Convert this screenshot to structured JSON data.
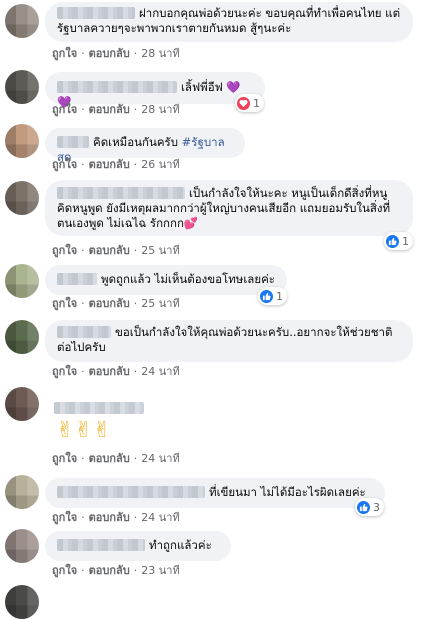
{
  "action_labels": {
    "like": "ถูกใจ",
    "reply": "ตอบกลับ",
    "separator": "·"
  },
  "comments": [
    {
      "text": "ฝากบอกคุณพ่อด้วยนะค่ะ ขอบคุณที่ทำเพื่อคนไทย แต่รัฐบาลควายๆจะพาพวกเราตายกันหมด สู้ๆนะค่ะ",
      "time": "28 นาที"
    },
    {
      "text": "เลิ้ฟพี่อีฟ 💜💜",
      "time": "28 นาที",
      "reaction": {
        "icon": "heart-icon",
        "count": "1"
      }
    },
    {
      "text": "คิดเหมือนกันครับ ",
      "hashtag": "#รัฐบาลสด",
      "time": "26 นาที"
    },
    {
      "text": "เป็นกำลังใจให้นะคะ หนูเป็นเด็กดีสิ่งที่หนูคิดหนูพูด ยังมีเหตุผลมากกว่าผู้ใหญ่บางคนเสียอีก แถมยอมรับในสิ่งที่ตนเองพูด ไม่เฉไฉ รักกกก💕",
      "time": "25 นาที",
      "reaction": {
        "icon": "like-icon",
        "count": "1"
      }
    },
    {
      "text": "พูดถูกแล้ว ไม่เห็นต้องขอโทษเลยค่ะ",
      "time": "25 นาที",
      "reaction": {
        "icon": "like-icon",
        "count": "1"
      }
    },
    {
      "text": "ขอเป็นกำลังใจให้คุณพ่อด้วยนะครับ..อยากจะให้ช่วยชาติต่อไปครับ",
      "time": "24 นาที"
    },
    {
      "text": "✌✌✌",
      "time": "24 นาที"
    },
    {
      "text": "ที่เขียนมา ไม่ได้มีอะไรผิดเลยค่ะ",
      "time": "24 นาที",
      "reaction": {
        "icon": "like-icon",
        "count": "3"
      }
    },
    {
      "text": "ทำถูกแล้วค่ะ",
      "time": "23 นาที"
    }
  ]
}
